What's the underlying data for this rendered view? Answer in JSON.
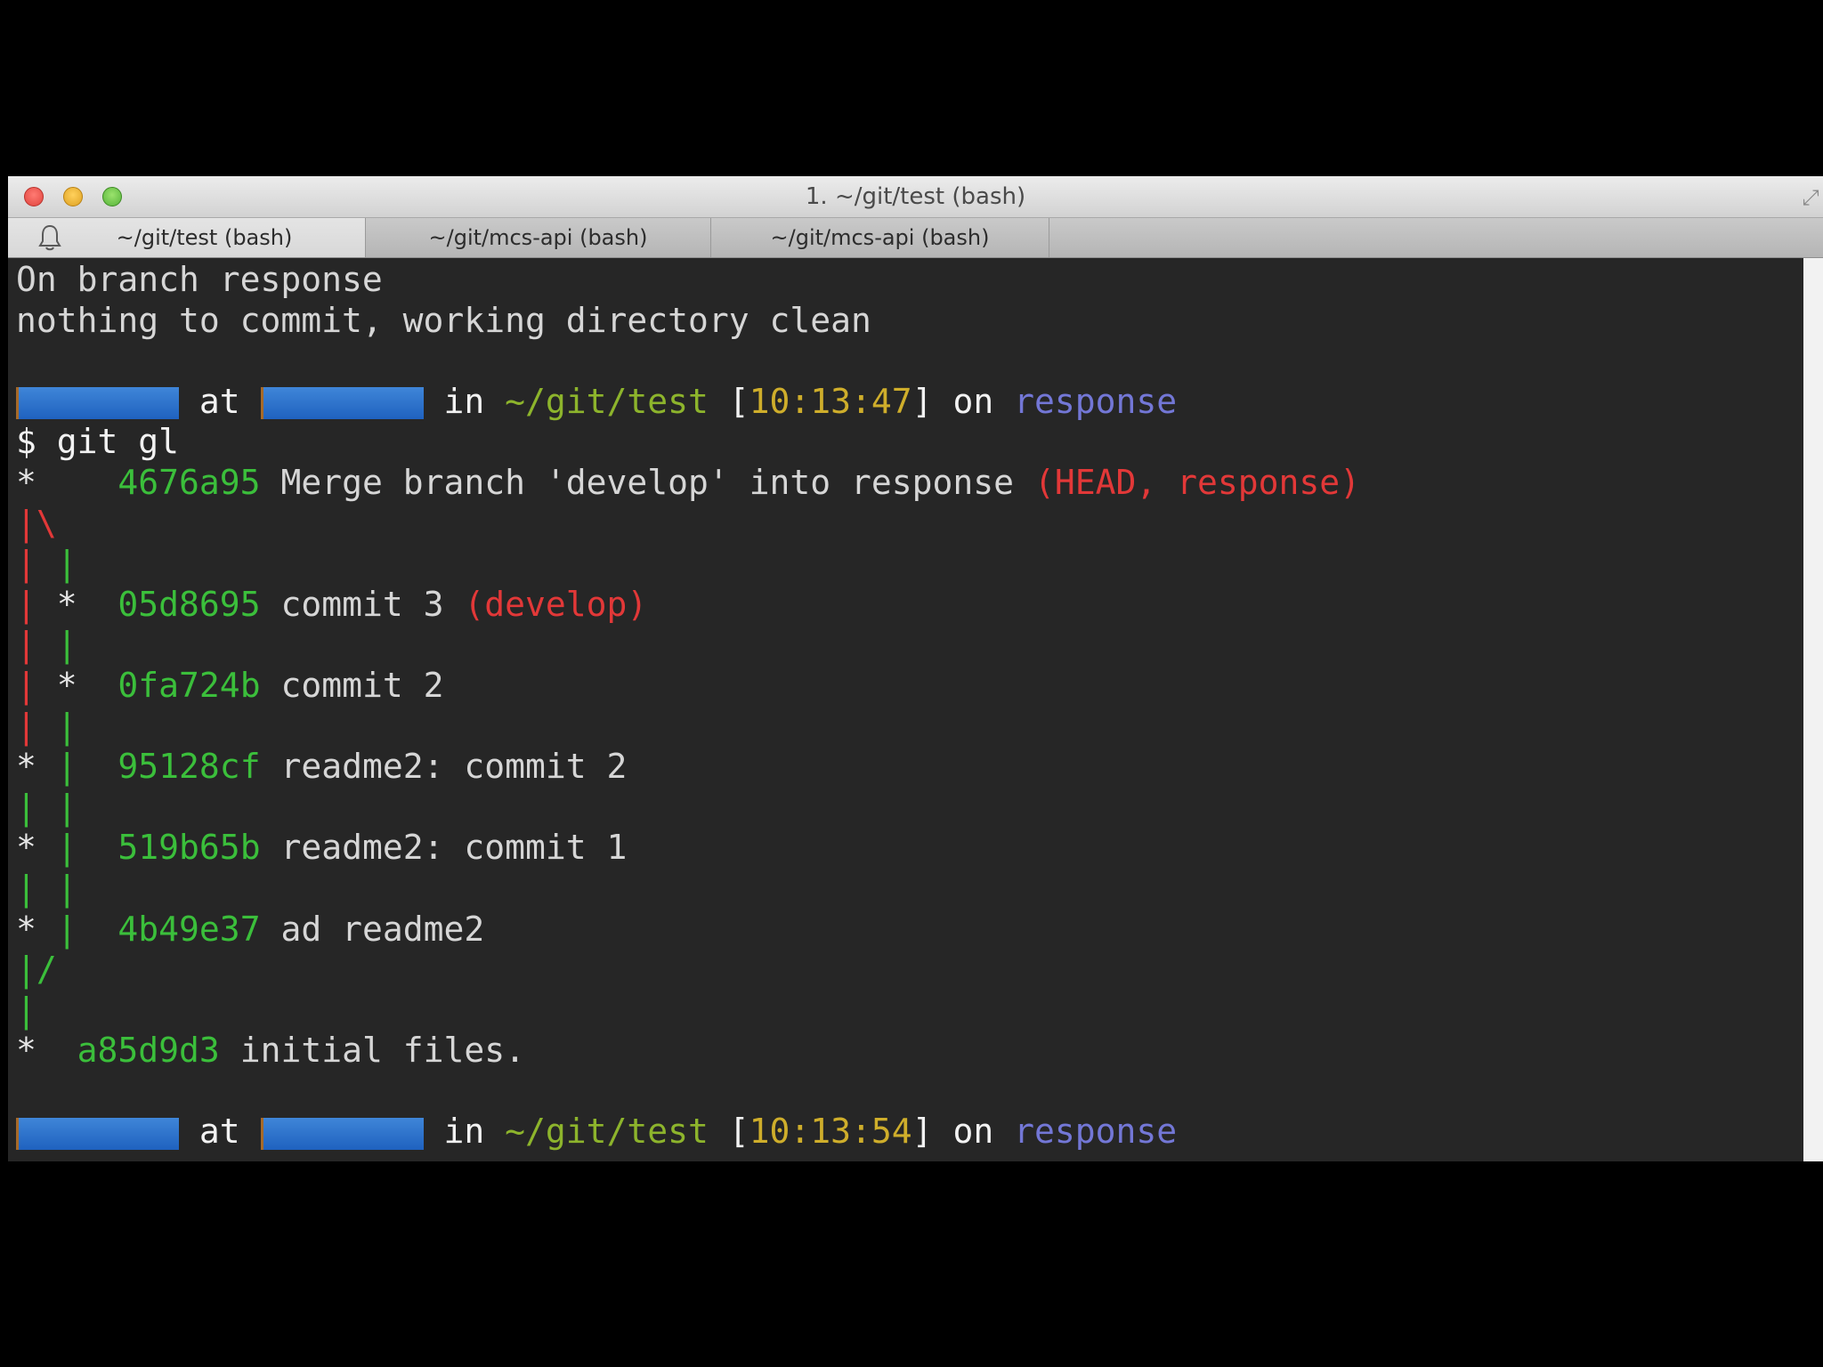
{
  "window": {
    "title": "1. ~/git/test (bash)"
  },
  "tabs": [
    {
      "label": "~/git/test (bash)",
      "active": true
    },
    {
      "label": "~/git/mcs-api (bash)",
      "active": false
    },
    {
      "label": "~/git/mcs-api (bash)",
      "active": false
    }
  ],
  "icons": {
    "bell": "bell-icon",
    "fullscreen": "fullscreen-icon"
  },
  "colors": {
    "hash": "#3bbf3b",
    "ref": "#e23838",
    "time": "#cfae2b",
    "path": "#8db42c",
    "branch": "#7377d6",
    "redaction": "#2a6fcf"
  },
  "terminal": {
    "status_line1": "On branch response",
    "status_line2": "nothing to commit, working directory clean",
    "prompt1": {
      "at": "at",
      "in": "in",
      "path": "~/git/test",
      "bracket_open": "[",
      "time": "10:13:47",
      "bracket_close": "]",
      "on": "on",
      "branch": "response"
    },
    "command_line": "$ git gl",
    "log": [
      {
        "graph": "*    ",
        "hash": "4676a95",
        "message": "Merge branch 'develop' into response",
        "refs": "(HEAD, response)"
      },
      {
        "graph": "|\\"
      },
      {
        "graph": "| |"
      },
      {
        "graph": "| *  ",
        "hash": "05d8695",
        "message": "commit 3",
        "refs": "(develop)"
      },
      {
        "graph": "| |"
      },
      {
        "graph": "| *  ",
        "hash": "0fa724b",
        "message": "commit 2"
      },
      {
        "graph": "| |"
      },
      {
        "graph": "* |  ",
        "hash": "95128cf",
        "message": "readme2: commit 2"
      },
      {
        "graph": "| |"
      },
      {
        "graph": "* |  ",
        "hash": "519b65b",
        "message": "readme2: commit 1"
      },
      {
        "graph": "| |"
      },
      {
        "graph": "* |  ",
        "hash": "4b49e37",
        "message": "ad readme2"
      },
      {
        "graph": "|/"
      },
      {
        "graph": "|"
      },
      {
        "graph": "*  ",
        "hash": "a85d9d3",
        "message": "initial files."
      }
    ],
    "prompt2": {
      "at": "at",
      "in": "in",
      "path": "~/git/test",
      "bracket_open": "[",
      "time": "10:13:54",
      "bracket_close": "]",
      "on": "on",
      "branch": "response"
    }
  }
}
